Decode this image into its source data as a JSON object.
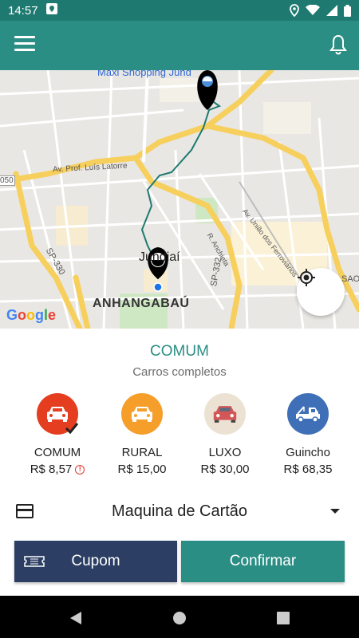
{
  "status_bar": {
    "time": "14:57"
  },
  "map": {
    "labels": {
      "shopping": "Maxi Shopping Jund",
      "av_luis": "Av. Prof. Luís Latorre",
      "av_uniao": "Av. União dos Ferroviários",
      "r_anchieta": "R. Anchieta",
      "sp330": "SP-330",
      "sp332": "SP-332",
      "jundiai": "Jundiaí",
      "anhangabau": "ANHANGABAÚ",
      "sao": "SAO",
      "road050": "050"
    },
    "google": "Google"
  },
  "service": {
    "title": "COMUM",
    "subtitle": "Carros completos"
  },
  "vehicles": [
    {
      "name": "COMUM",
      "price": "R$ 8,57",
      "color": "#e53d1f",
      "icon": "car-icon",
      "selected": true
    },
    {
      "name": "RURAL",
      "price": "R$ 15,00",
      "color": "#f59e2a",
      "icon": "car-icon"
    },
    {
      "name": "LUXO",
      "price": "R$ 30,00",
      "color": "#ebe2d4",
      "icon": "car-icon"
    },
    {
      "name": "Guincho",
      "price": "R$ 68,35",
      "color": "#3f6fb6",
      "icon": "tow-truck-icon"
    }
  ],
  "payment": {
    "label": "Maquina de Cartão"
  },
  "buttons": {
    "cupom": "Cupom",
    "confirm": "Confirmar"
  },
  "colors": {
    "primary": "#2b8e84",
    "dark_blue": "#2c3e63",
    "alert": "#e53935"
  }
}
